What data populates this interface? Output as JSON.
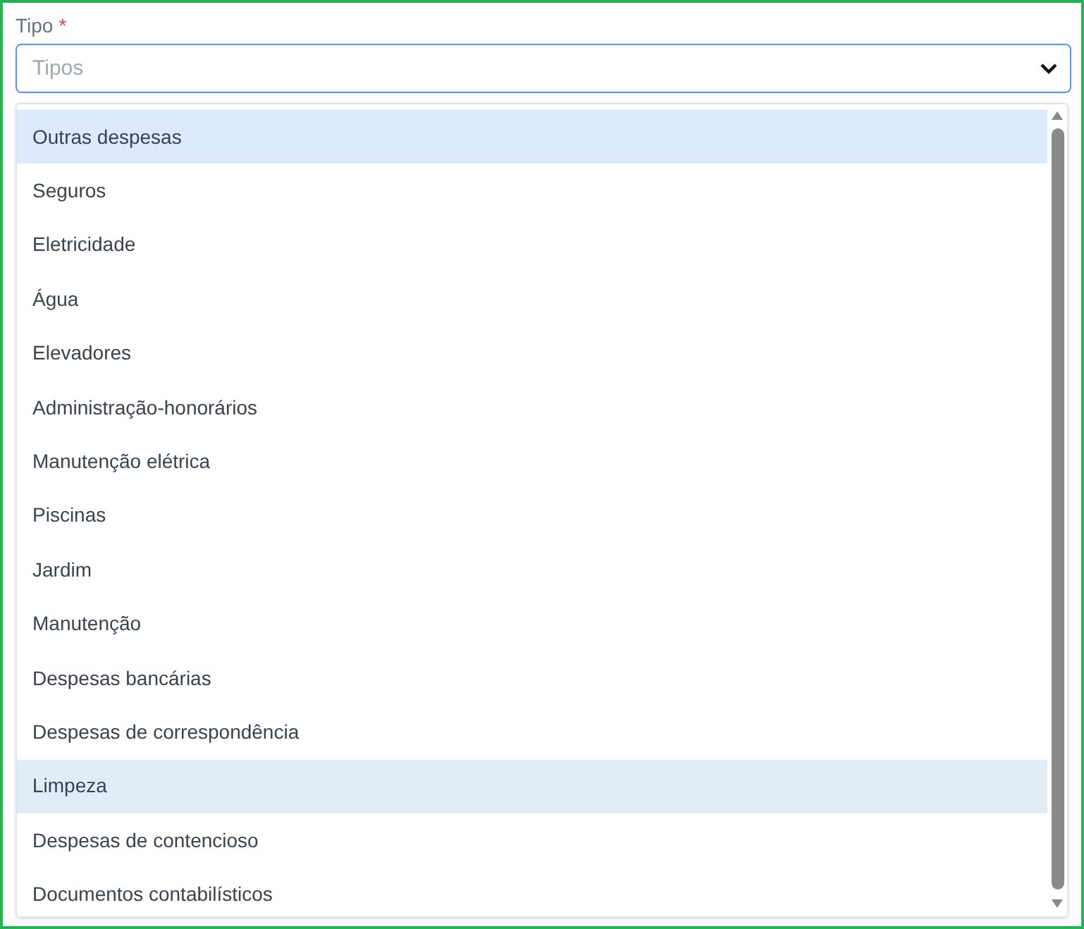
{
  "field": {
    "label": "Tipo",
    "required_mark": "*",
    "placeholder": "Tipos"
  },
  "options": [
    {
      "label": "Outras despesas",
      "selected": true,
      "hovered": false
    },
    {
      "label": "Seguros",
      "selected": false,
      "hovered": false
    },
    {
      "label": "Eletricidade",
      "selected": false,
      "hovered": false
    },
    {
      "label": "Água",
      "selected": false,
      "hovered": false
    },
    {
      "label": "Elevadores",
      "selected": false,
      "hovered": false
    },
    {
      "label": "Administração-honorários",
      "selected": false,
      "hovered": false
    },
    {
      "label": "Manutenção elétrica",
      "selected": false,
      "hovered": false
    },
    {
      "label": "Piscinas",
      "selected": false,
      "hovered": false
    },
    {
      "label": "Jardim",
      "selected": false,
      "hovered": false
    },
    {
      "label": "Manutenção",
      "selected": false,
      "hovered": false
    },
    {
      "label": "Despesas bancárias",
      "selected": false,
      "hovered": false
    },
    {
      "label": "Despesas de correspondência",
      "selected": false,
      "hovered": false
    },
    {
      "label": "Limpeza",
      "selected": false,
      "hovered": true
    },
    {
      "label": "Despesas de contencioso",
      "selected": false,
      "hovered": false
    },
    {
      "label": "Documentos contabilísticos",
      "selected": false,
      "hovered": false
    }
  ]
}
